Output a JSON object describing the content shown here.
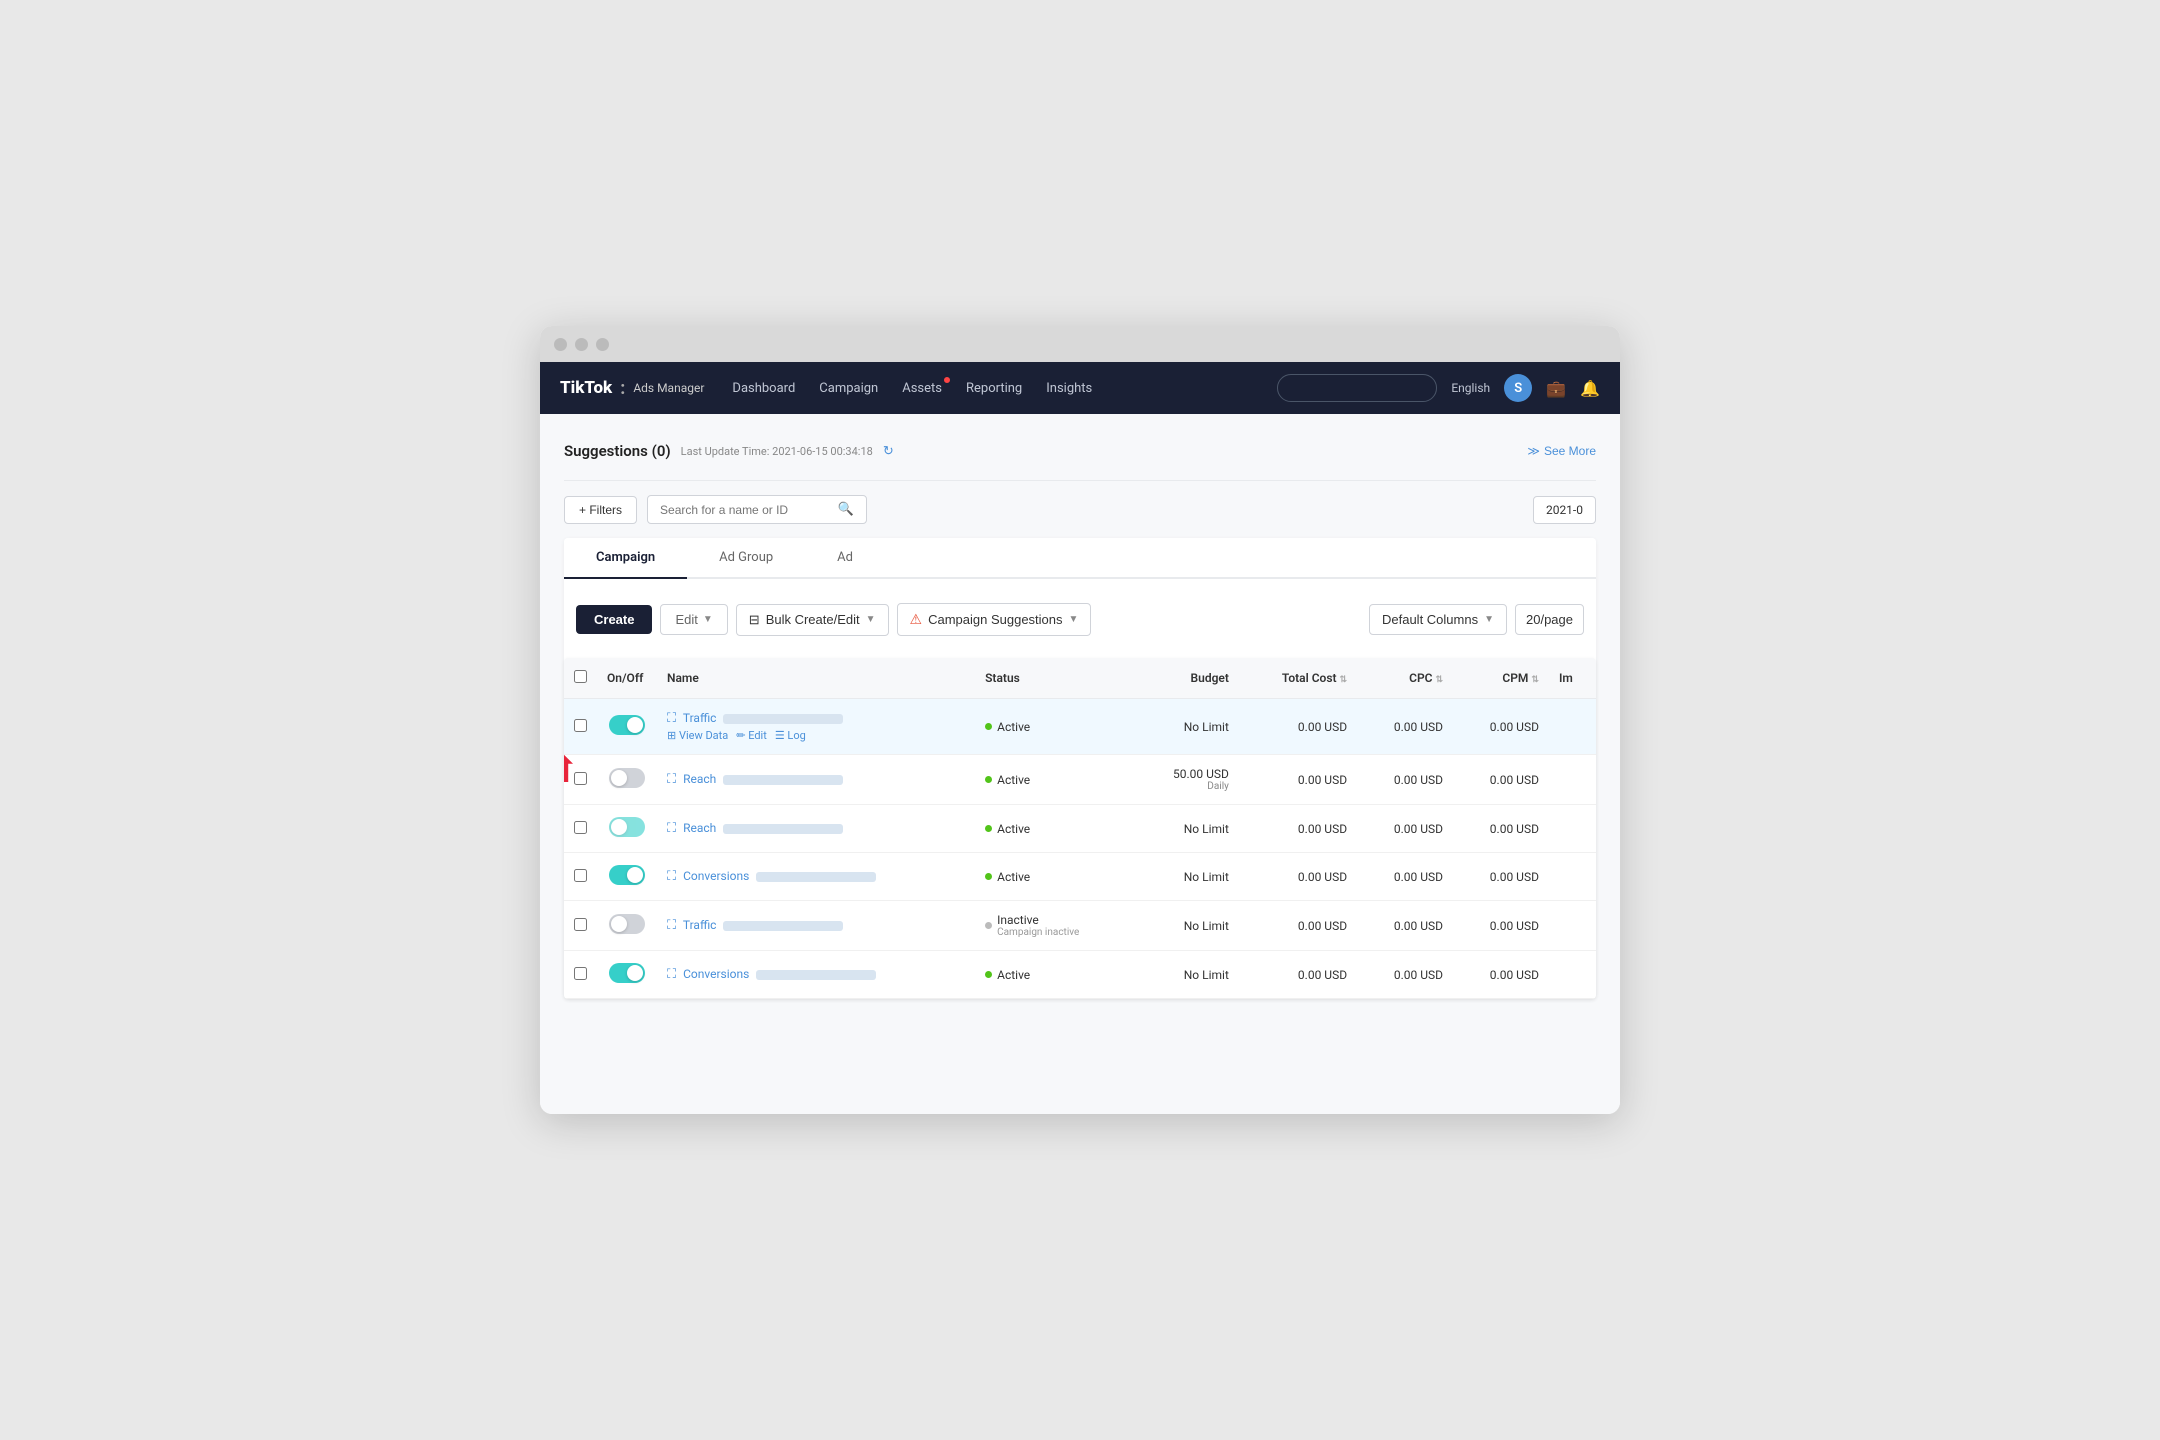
{
  "window": {
    "title": "TikTok Ads Manager"
  },
  "navbar": {
    "brand": "TikTok",
    "brand_sub": "Ads Manager",
    "items": [
      {
        "label": "Dashboard",
        "has_dot": false
      },
      {
        "label": "Campaign",
        "has_dot": false
      },
      {
        "label": "Assets",
        "has_dot": true
      },
      {
        "label": "Reporting",
        "has_dot": false
      },
      {
        "label": "Insights",
        "has_dot": false
      }
    ],
    "lang": "English",
    "avatar_letter": "S",
    "search_placeholder": ""
  },
  "suggestions": {
    "title": "Suggestions (0)",
    "update_label": "Last Update Time: 2021-06-15 00:34:18",
    "see_more": "See More"
  },
  "toolbar": {
    "filter_label": "+ Filters",
    "search_placeholder": "Search for a name or ID",
    "date_value": "2021-0",
    "tabs": [
      "Campaign",
      "Ad Group",
      "Ad"
    ],
    "active_tab": "Campaign",
    "create_label": "Create",
    "edit_label": "Edit",
    "bulk_label": "Bulk Create/Edit",
    "campaign_suggestions_label": "Campaign Suggestions",
    "default_columns_label": "Default Columns",
    "per_page_label": "20/page"
  },
  "table": {
    "headers": [
      "On/Off",
      "Name",
      "Status",
      "Budget",
      "Total Cost",
      "CPC",
      "CPM",
      "Im"
    ],
    "rows": [
      {
        "id": 1,
        "toggle": "on",
        "type": "Traffic",
        "name_blurred": true,
        "show_actions": true,
        "status": "Active",
        "status_type": "active",
        "status_sub": "",
        "budget": "No Limit",
        "budget_sub": "",
        "total_cost": "0.00 USD",
        "cpc": "0.00 USD",
        "cpm": "0.00 USD",
        "highlighted": true
      },
      {
        "id": 2,
        "toggle": "off",
        "type": "Reach",
        "name_blurred": true,
        "show_actions": false,
        "status": "Active",
        "status_type": "active",
        "status_sub": "",
        "budget": "50.00 USD",
        "budget_sub": "Daily",
        "total_cost": "0.00 USD",
        "cpc": "0.00 USD",
        "cpm": "0.00 USD",
        "highlighted": false,
        "has_arrow": true
      },
      {
        "id": 3,
        "toggle": "partial",
        "type": "Reach",
        "name_blurred": true,
        "show_actions": false,
        "status": "Active",
        "status_type": "active",
        "status_sub": "",
        "budget": "No Limit",
        "budget_sub": "",
        "total_cost": "0.00 USD",
        "cpc": "0.00 USD",
        "cpm": "0.00 USD",
        "highlighted": false
      },
      {
        "id": 4,
        "toggle": "on",
        "type": "Conversions",
        "name_blurred": true,
        "show_actions": false,
        "status": "Active",
        "status_type": "active",
        "status_sub": "",
        "budget": "No Limit",
        "budget_sub": "",
        "total_cost": "0.00 USD",
        "cpc": "0.00 USD",
        "cpm": "0.00 USD",
        "highlighted": false
      },
      {
        "id": 5,
        "toggle": "off",
        "type": "Traffic",
        "name_blurred": true,
        "show_actions": false,
        "status": "Inactive",
        "status_type": "inactive",
        "status_sub": "Campaign inactive",
        "budget": "No Limit",
        "budget_sub": "",
        "total_cost": "0.00 USD",
        "cpc": "0.00 USD",
        "cpm": "0.00 USD",
        "highlighted": false
      },
      {
        "id": 6,
        "toggle": "on",
        "type": "Conversions",
        "name_blurred": true,
        "show_actions": false,
        "status": "Active",
        "status_type": "active",
        "status_sub": "",
        "budget": "No Limit",
        "budget_sub": "",
        "total_cost": "0.00 USD",
        "cpc": "0.00 USD",
        "cpm": "0.00 USD",
        "highlighted": false
      }
    ]
  }
}
